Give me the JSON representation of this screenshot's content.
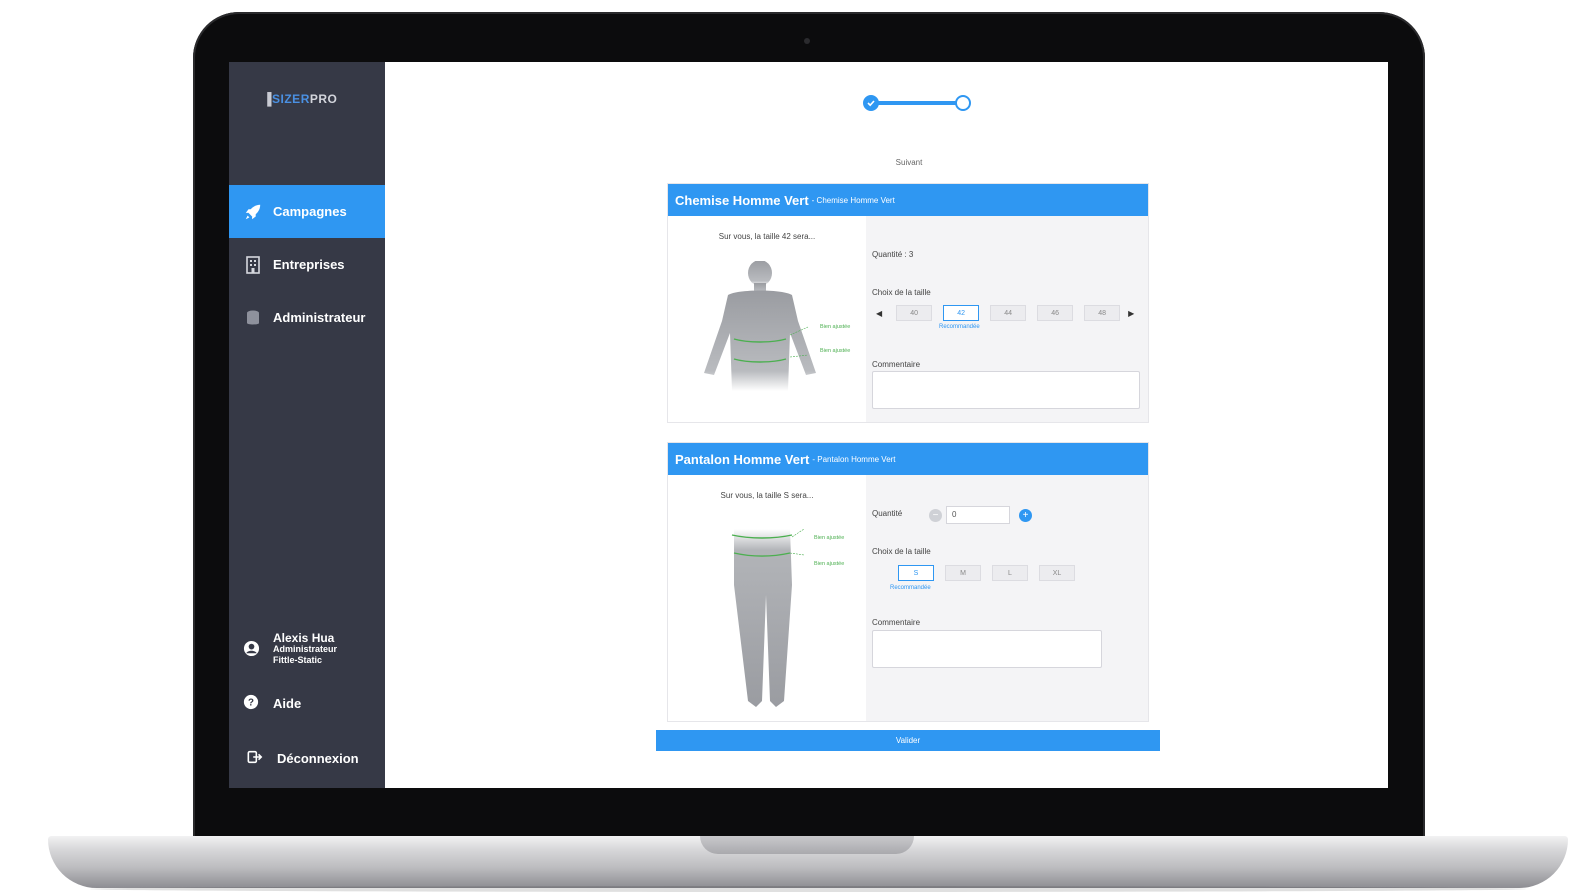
{
  "sidebar": {
    "logo": {
      "part1": "▐",
      "part2": "SIZER",
      "part3": "PRO"
    },
    "nav": [
      {
        "label": "Campagnes",
        "icon": "rocket-icon"
      },
      {
        "label": "Entreprises",
        "icon": "building-icon"
      },
      {
        "label": "Administrateur",
        "icon": "database-icon"
      }
    ],
    "user": {
      "name": "Alexis Hua",
      "role": "Administrateur",
      "company": "Fittle-Static",
      "icon": "user-icon"
    },
    "help": {
      "label": "Aide",
      "icon": "help-icon"
    },
    "logout": {
      "label": "Déconnexion",
      "icon": "logout-icon"
    }
  },
  "stepper": {
    "label": "Suivant"
  },
  "products": [
    {
      "title": "Chemise Homme Vert",
      "subtitle": "- Chemise Homme Vert",
      "fit_text": "Sur vous, la taille 42 sera...",
      "quantity_label": "Quantité : 3",
      "size_label": "Choix de la taille",
      "sizes": [
        "40",
        "42",
        "44",
        "46",
        "48"
      ],
      "selected_size": "42",
      "recommended_label": "Recommandée",
      "comment_label": "Commentaire",
      "measures": [
        "Bien ajustée",
        "Bien ajustée"
      ]
    },
    {
      "title": "Pantalon Homme Vert",
      "subtitle": "- Pantalon Homme Vert",
      "fit_text": "Sur vous, la taille S sera...",
      "quantity_label": "Quantité",
      "quantity_value": "0",
      "size_label": "Choix de la taille",
      "sizes": [
        "S",
        "M",
        "L",
        "XL"
      ],
      "selected_size": "S",
      "recommended_label": "Recommandée",
      "comment_label": "Commentaire",
      "measures": [
        "Bien ajustée",
        "Bien ajustée"
      ]
    }
  ],
  "validate_label": "Valider",
  "colors": {
    "accent": "#2f97f2",
    "sidebar": "#363946",
    "fit": "#4caf50"
  }
}
